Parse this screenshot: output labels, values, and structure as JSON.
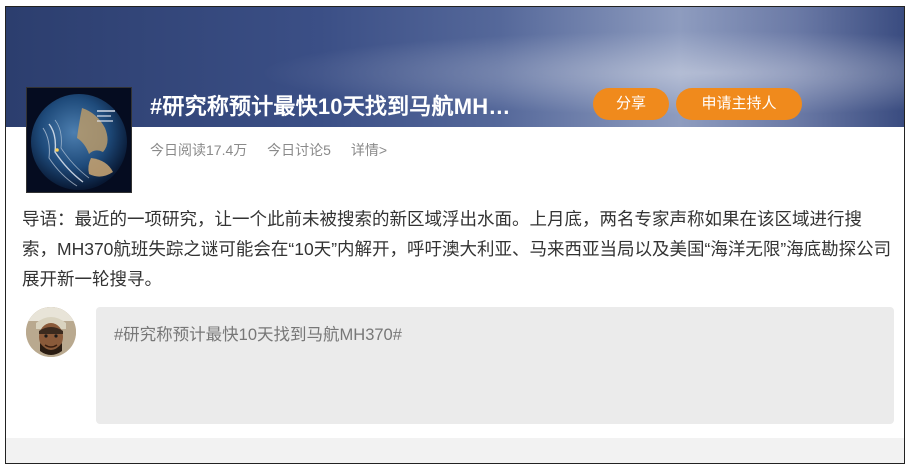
{
  "topic": {
    "title": "#研究称预计最快10天找到马航MH…",
    "share_label": "分享",
    "apply_host_label": "申请主持人",
    "stats": {
      "reads": "今日阅读17.4万",
      "discussions": "今日讨论5",
      "details": "详情>"
    },
    "intro": "导语：最近的一项研究，让一个此前未被搜索的新区域浮出水面。上月底，两名专家声称如果在该区域进行搜索，MH370航班失踪之谜可能会在“10天”内解开，呼吁澳大利亚、马来西亚当局以及美国“海洋无限”海底勘探公司展开新一轮搜寻。"
  },
  "comment": {
    "placeholder_text": "#研究称预计最快10天找到马航MH370#"
  },
  "colors": {
    "accent_button": "#f08a1c",
    "banner_dark": "#2c3e6e"
  }
}
